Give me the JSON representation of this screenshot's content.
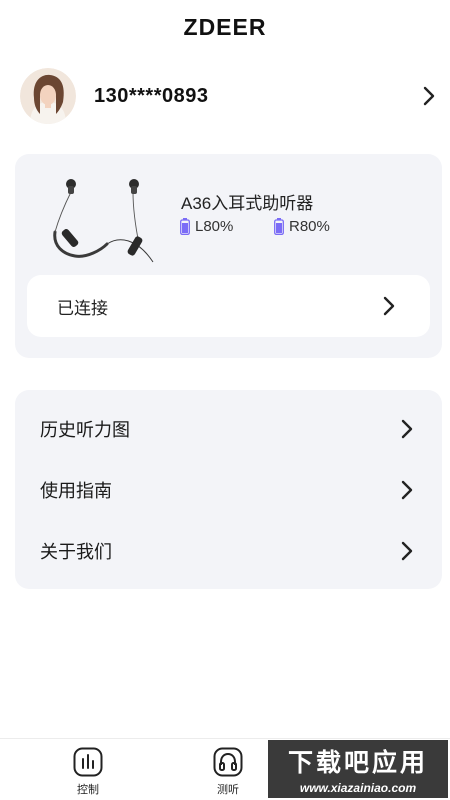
{
  "header": {
    "title": "ZDEER"
  },
  "profile": {
    "phone": "130****0893",
    "avatar_icon": "user-avatar"
  },
  "device": {
    "name": "A36入耳式助听器",
    "battery_left": "L80%",
    "battery_right": "R80%",
    "battery_color": "#7b6cf6",
    "status": "已连接"
  },
  "menu": {
    "items": [
      {
        "label": "历史听力图"
      },
      {
        "label": "使用指南"
      },
      {
        "label": "关于我们"
      }
    ]
  },
  "bottom_nav": {
    "items": [
      {
        "label": "控制",
        "icon": "equalizer-icon"
      },
      {
        "label": "测听",
        "icon": "headphones-icon"
      }
    ]
  },
  "watermark": {
    "title": "下载吧应用",
    "url": "www.xiazainiao.com"
  }
}
